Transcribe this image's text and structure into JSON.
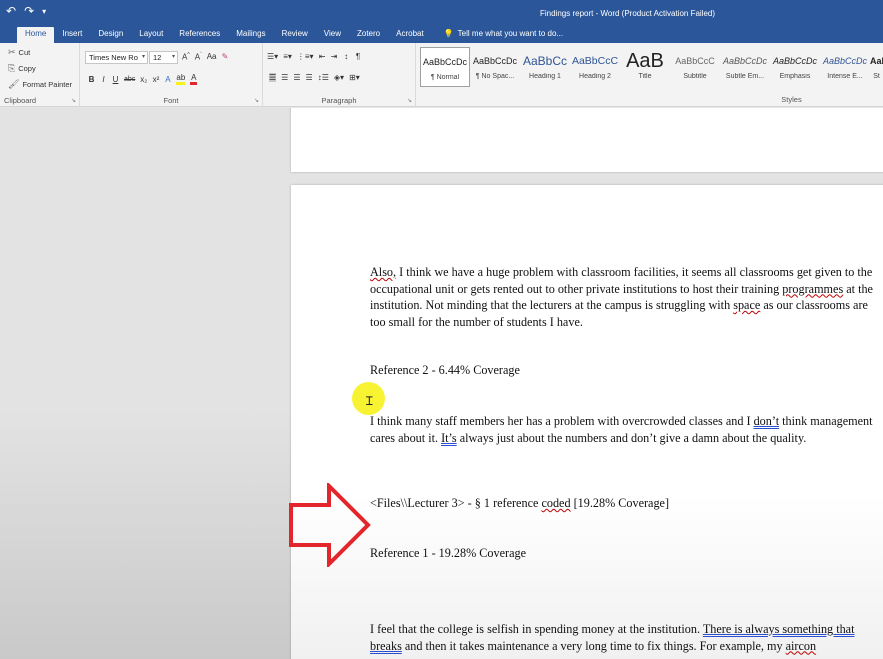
{
  "window": {
    "title": "Findings report - Word (Product Activation Failed)",
    "qat": {
      "save_icon": "save-icon",
      "undo_icon": "undo-icon",
      "redo_icon": "redo-icon"
    }
  },
  "tabs": [
    "Home",
    "Insert",
    "Design",
    "Layout",
    "References",
    "Mailings",
    "Review",
    "View",
    "Zotero",
    "Acrobat"
  ],
  "active_tab": "Home",
  "tell_me": "Tell me what you want to do...",
  "ribbon": {
    "clipboard": {
      "cut": "Cut",
      "copy": "Copy",
      "format_painter": "Format Painter",
      "label": "Clipboard"
    },
    "font": {
      "name": "Times New Ro",
      "size": "12",
      "label": "Font",
      "bold": "B",
      "italic": "I",
      "underline": "U",
      "strike": "abc",
      "sub": "x₂",
      "sup": "x²",
      "grow": "A",
      "shrink": "A",
      "case": "Aa"
    },
    "paragraph": {
      "label": "Paragraph"
    },
    "styles": {
      "label": "Styles",
      "items": [
        {
          "sample": "AaBbCcDc",
          "name": "¶ Normal"
        },
        {
          "sample": "AaBbCcDc",
          "name": "¶ No Spac..."
        },
        {
          "sample": "AaBbCc",
          "name": "Heading 1"
        },
        {
          "sample": "AaBbCcC",
          "name": "Heading 2"
        },
        {
          "sample": "AaB",
          "name": "Title"
        },
        {
          "sample": "AaBbCcC",
          "name": "Subtitle"
        },
        {
          "sample": "AaBbCcDc",
          "name": "Subtle Em..."
        },
        {
          "sample": "AaBbCcDc",
          "name": "Emphasis"
        },
        {
          "sample": "AaBbCcDc",
          "name": "Intense E..."
        },
        {
          "sample": "AaB",
          "name": "St"
        }
      ]
    }
  },
  "document": {
    "p1": {
      "w1": "Also,",
      "t1": " I think we have a huge problem with classroom facilities, it seems all classrooms get given to the occupational unit or gets rented out to other private institutions to host their training ",
      "w2": "programmes",
      "t2": " at the institution. Not minding that the lecturers at the campus is struggling with ",
      "w3": "space",
      "t3": " as our classrooms are too small for the number of students I have."
    },
    "ref2": "Reference 2 - 6.44% Coverage",
    "p2": {
      "t1": "I think many staff members her has a problem with overcrowded classes and I ",
      "w1": "don’t",
      "t2": " think management cares about it. ",
      "w2": "It’s",
      "t3": " always just about the numbers and don’t give a damn about the quality."
    },
    "files_line": {
      "t1": "<Files\\\\Lecturer 3> - § 1 reference ",
      "w1": "coded",
      "t2": "  [19.28% Coverage]"
    },
    "ref1": "Reference 1 - 19.28% Coverage",
    "p3": {
      "t1": "I feel that the college is selfish in spending money at the institution. ",
      "w1": "There is always something that breaks",
      "t2": " and then it takes maintenance a very long time to fix things. For example, my ",
      "w2": "aircon"
    }
  },
  "annotations": {
    "arrow_color": "#e3262b",
    "highlight_color": "#f7f21c"
  }
}
